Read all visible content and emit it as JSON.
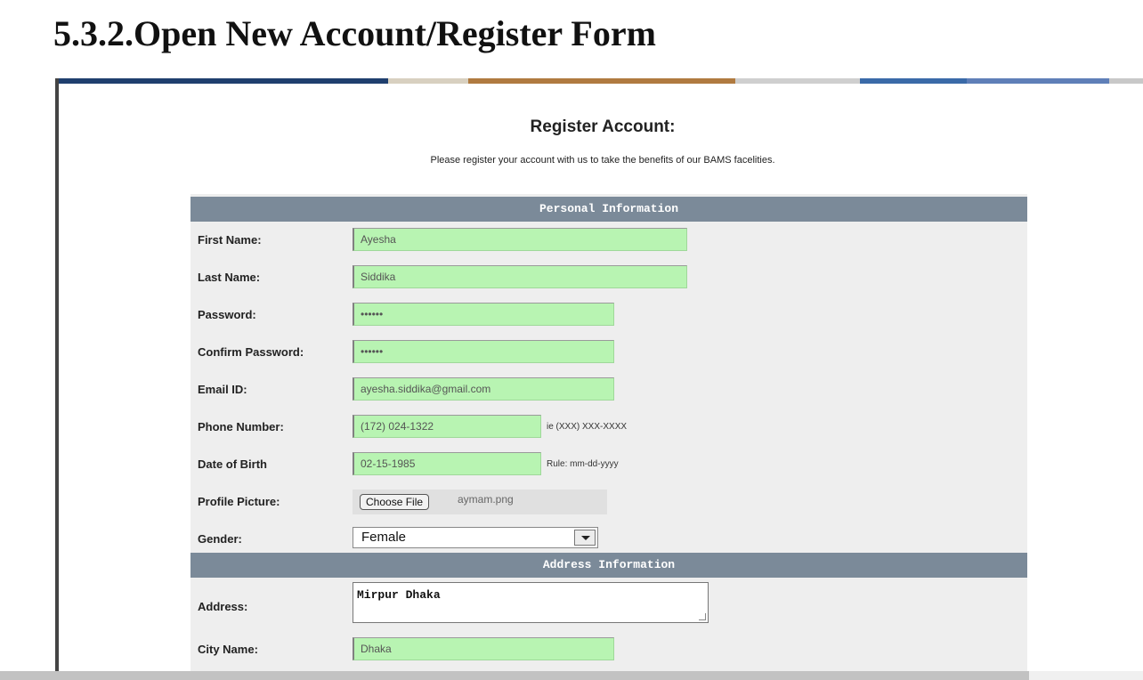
{
  "document": {
    "heading": "5.3.2.Open New Account/Register Form"
  },
  "topbar": {
    "colors": [
      "#1f3f6e",
      "#d8d0c0",
      "#b07a40",
      "#3a6aa8",
      "#5f7fb8",
      "#cfcfcf"
    ]
  },
  "page": {
    "title": "Register Account:",
    "subtitle": "Please register your account with us to take the benefits of our BAMS facelities."
  },
  "personal": {
    "header": "Personal Information",
    "first_name": {
      "label": "First Name:",
      "value": "Ayesha"
    },
    "last_name": {
      "label": "Last Name:",
      "value": "Siddika"
    },
    "password": {
      "label": "Password:",
      "value": "••••••"
    },
    "confirm_password": {
      "label": "Confirm Password:",
      "value": "••••••"
    },
    "email": {
      "label": "Email ID:",
      "value": "ayesha.siddika@gmail.com"
    },
    "phone": {
      "label": "Phone Number:",
      "value": "(172) 024-1322",
      "hint": "ie (XXX) XXX-XXXX"
    },
    "dob": {
      "label": "Date of Birth",
      "value": "02-15-1985",
      "hint": "Rule: mm-dd-yyyy"
    },
    "picture": {
      "label": "Profile Picture:",
      "button": "Choose File",
      "file": "aymam.png"
    },
    "gender": {
      "label": "Gender:",
      "value": "Female"
    }
  },
  "address": {
    "header": "Address Information",
    "address": {
      "label": "Address:",
      "value": "Mirpur Dhaka"
    },
    "city": {
      "label": "City Name:",
      "value": "Dhaka"
    }
  },
  "colors": {
    "field_bg": "#b8f4b2",
    "section_bg": "#7b8a99",
    "panel_bg": "#eeeeee"
  }
}
